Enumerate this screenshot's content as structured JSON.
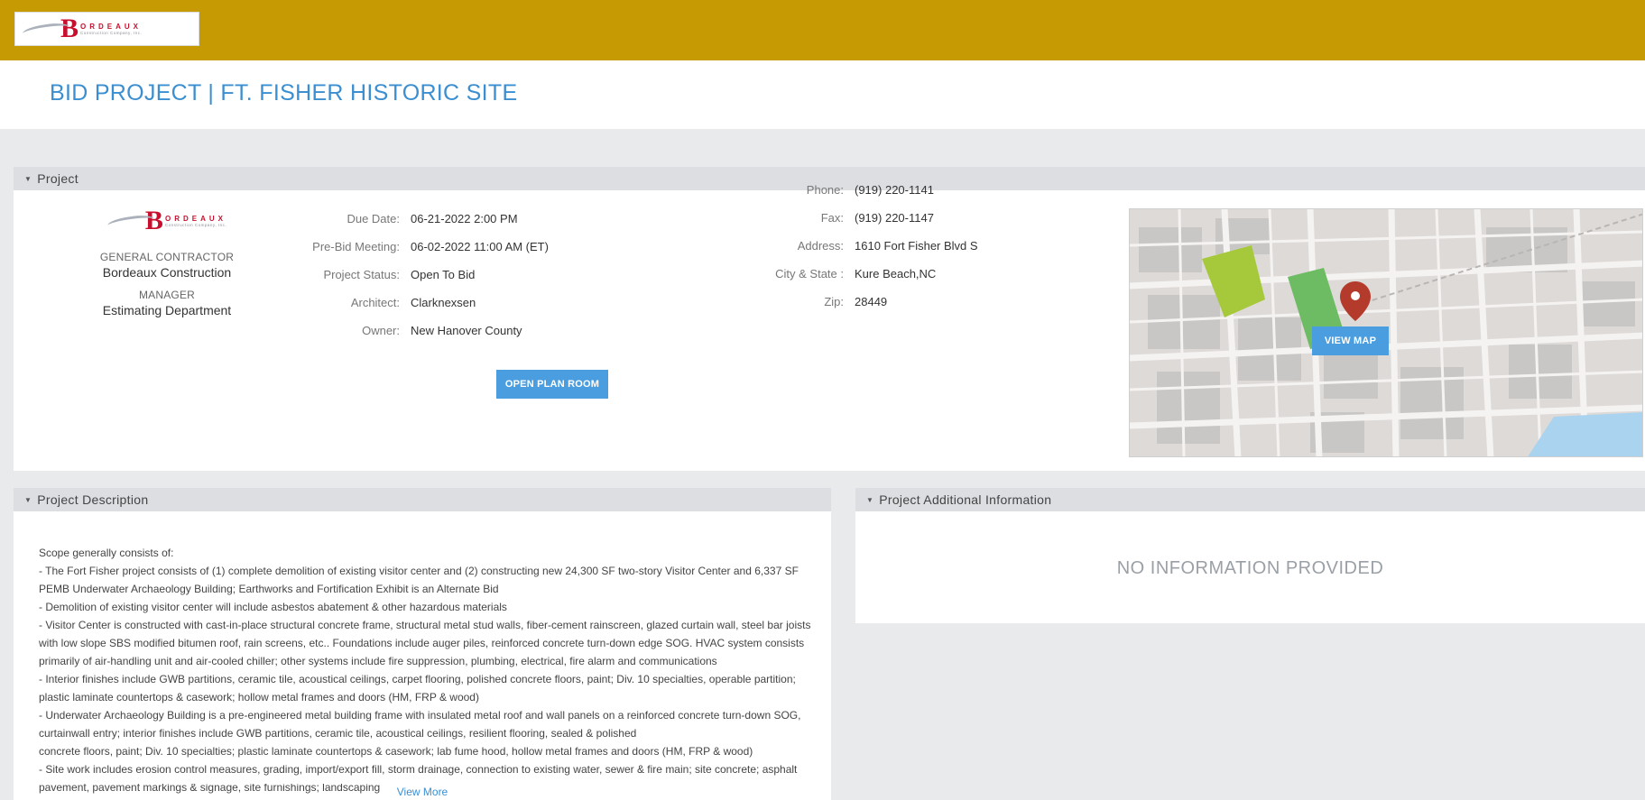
{
  "brand": {
    "logo_letter": "B",
    "logo_word": "ORDEAUX",
    "logo_sub": "Construction Company, Inc.",
    "red": "#c8102e",
    "header_color": "#c69a02",
    "accent": "#3b8fd1"
  },
  "page_title": "BID PROJECT  |  FT. FISHER HISTORIC SITE",
  "project_panel": {
    "header": "Project",
    "contractor": {
      "general_contractor_label": "GENERAL CONTRACTOR",
      "general_contractor": "Bordeaux Construction",
      "manager_label": "MANAGER",
      "manager": "Estimating Department"
    },
    "details": [
      {
        "label": "Due Date:",
        "value": "06-21-2022 2:00 PM"
      },
      {
        "label": "Pre-Bid Meeting:",
        "value": "06-02-2022 11:00 AM (ET)"
      },
      {
        "label": "Project Status:",
        "value": "Open To Bid"
      },
      {
        "label": "Architect:",
        "value": "Clarknexsen"
      },
      {
        "label": "Owner:",
        "value": "New Hanover County"
      }
    ],
    "contact": [
      {
        "label": "Phone:",
        "value": "(919) 220-1141"
      },
      {
        "label": "Fax:",
        "value": "(919) 220-1147"
      },
      {
        "label": "Address:",
        "value": "1610 Fort Fisher Blvd S"
      },
      {
        "label": "City & State :",
        "value": "Kure Beach,NC"
      },
      {
        "label": "Zip:",
        "value": "28449"
      }
    ],
    "open_plan_room_label": "OPEN PLAN ROOM",
    "view_map_label": "VIEW MAP"
  },
  "description_panel": {
    "header": "Project Description",
    "lines": [
      "Scope generally consists of:",
      "- The Fort Fisher project consists of (1) complete demolition of existing visitor center and (2) constructing new 24,300 SF two-story Visitor Center and 6,337 SF PEMB Underwater Archaeology Building; Earthworks and Fortification Exhibit is an Alternate Bid",
      "- Demolition of existing visitor center will include asbestos abatement & other hazardous materials",
      "- Visitor Center is constructed with cast-in-place structural concrete frame, structural metal stud walls, fiber-cement rainscreen, glazed curtain wall, steel bar joists with low slope SBS modified bitumen roof, rain screens, etc.. Foundations include auger piles, reinforced concrete turn-down edge SOG. HVAC system consists primarily of air-handling unit and air-cooled chiller; other systems include fire suppression, plumbing, electrical, fire alarm and communications",
      "- Interior finishes include GWB partitions, ceramic tile, acoustical ceilings, carpet flooring, polished concrete floors, paint; Div. 10 specialties, operable partition; plastic laminate countertops & casework; hollow metal frames and doors (HM, FRP & wood)",
      "- Underwater Archaeology Building is a pre-engineered metal building frame with insulated metal roof and wall panels on a reinforced concrete turn-down SOG, curtainwall entry; interior finishes include GWB partitions, ceramic tile, acoustical ceilings, resilient flooring, sealed & polished",
      "concrete floors, paint; Div. 10 specialties; plastic laminate countertops & casework; lab fume hood, hollow metal frames and doors (HM, FRP & wood)",
      "- Site work includes erosion control measures, grading, import/export fill, storm drainage, connection to existing water, sewer & fire main; site concrete; asphalt pavement, pavement markings & signage, site furnishings; landscaping"
    ],
    "view_more_label": "View More"
  },
  "additional_panel": {
    "header": "Project Additional Information",
    "empty_text": "NO INFORMATION PROVIDED"
  }
}
